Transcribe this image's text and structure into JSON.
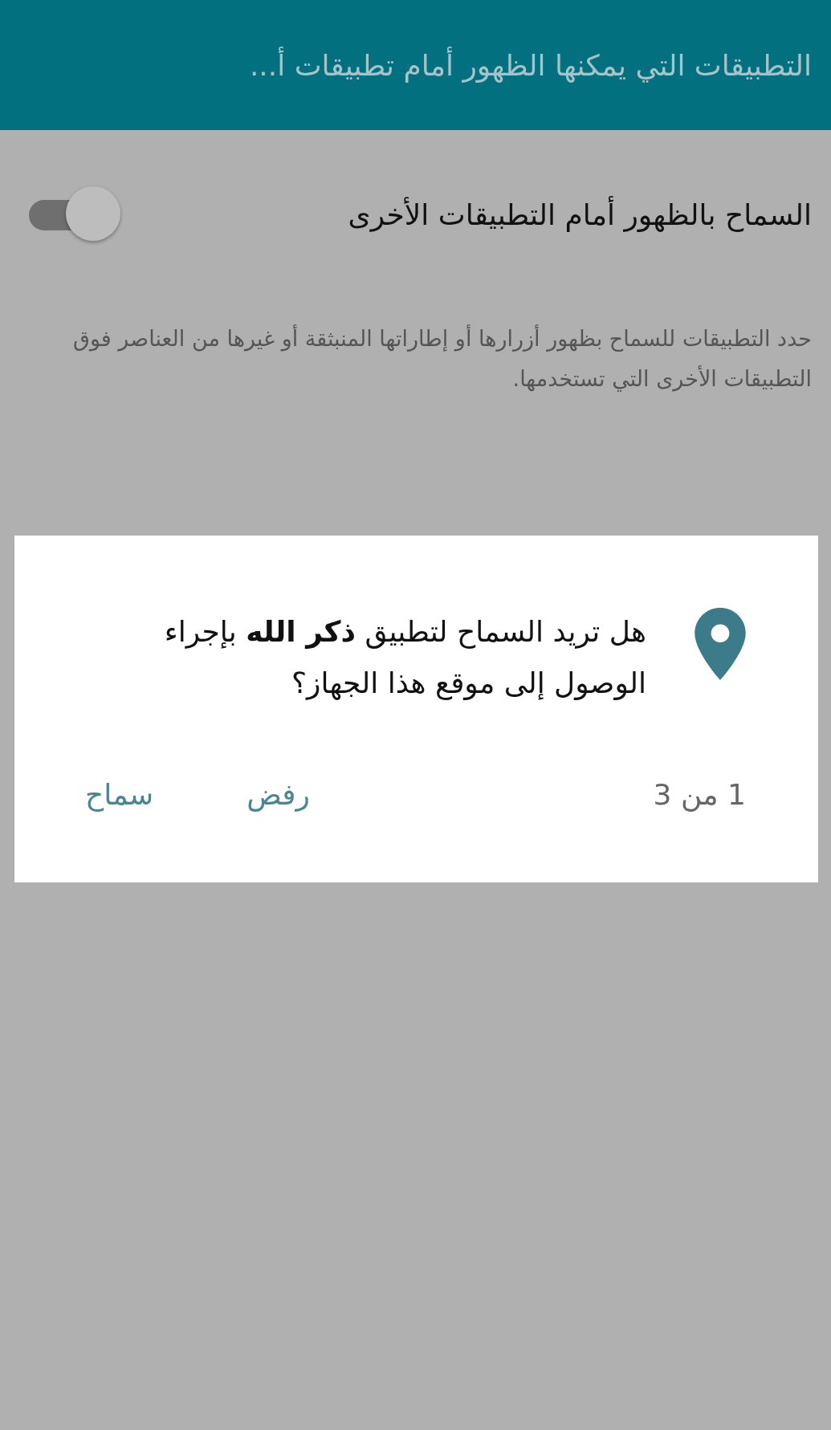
{
  "header": {
    "title": "التطبيقات التي يمكنها الظهور أمام تطبيقات أ..."
  },
  "setting": {
    "label": "السماح بالظهور أمام التطبيقات الأخرى",
    "on": false
  },
  "description": "حدد التطبيقات للسماح بظهور أزرارها أو إطاراتها المنبثقة أو غيرها من العناصر فوق التطبيقات الأخرى التي تستخدمها.",
  "dialog": {
    "message": "هل تريد السماح لتطبيق **ذكر الله** بإجراء الوصول إلى موقع هذا الجهاز؟",
    "counter": "1 من 3",
    "buttons": [
      "رفض",
      "سماح"
    ]
  }
}
